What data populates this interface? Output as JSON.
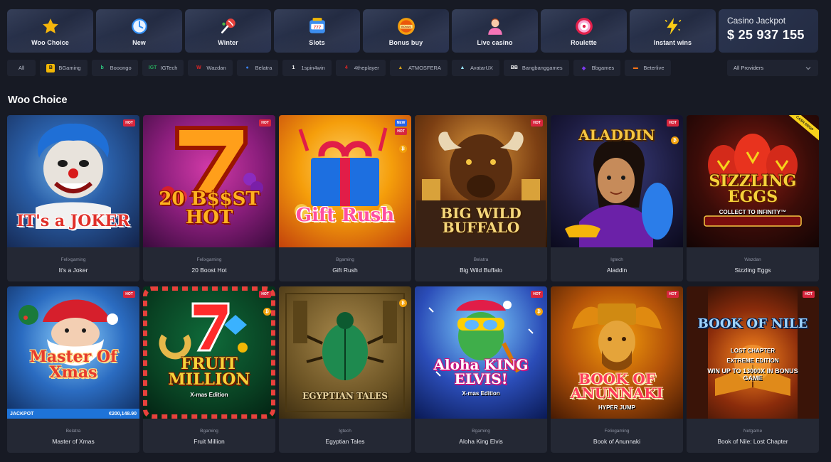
{
  "nav": {
    "categories": [
      {
        "label": "Woo Choice",
        "icon": "star-icon"
      },
      {
        "label": "New",
        "icon": "clock-icon"
      },
      {
        "label": "Winter",
        "icon": "candy-icon"
      },
      {
        "label": "Slots",
        "icon": "slot-machine-icon"
      },
      {
        "label": "Bonus buy",
        "icon": "bonus-coin-icon"
      },
      {
        "label": "Live casino",
        "icon": "dealer-icon"
      },
      {
        "label": "Roulette",
        "icon": "roulette-icon"
      },
      {
        "label": "Instant wins",
        "icon": "lightning-icon"
      }
    ],
    "jackpot": {
      "title": "Casino Jackpot",
      "amount": "$ 25 937 155"
    }
  },
  "providers": {
    "items": [
      "All",
      "BGaming",
      "Booongo",
      "IGTech",
      "Wazdan",
      "Belatra",
      "1spin4win",
      "4theplayer",
      "ATMOSFERA",
      "AvatarUX",
      "Bangbanggames",
      "Bbgames",
      "Beterlive"
    ],
    "logos": [
      "",
      "B",
      "b",
      "IGT",
      "W",
      "●",
      "1",
      "4",
      "▲",
      "▲",
      "BB",
      "◆",
      "▬"
    ],
    "logo_colors": [
      "",
      "#f2b705",
      "#2ec27e",
      "#27a35a",
      "#e02424",
      "#3b82f6",
      "#ffffff",
      "#e02424",
      "#d6a21a",
      "#9be7ff",
      "#ffffff",
      "#7c3aed",
      "#f97316"
    ],
    "select": {
      "value": "All Providers"
    }
  },
  "section": {
    "title": "Woo Choice"
  },
  "games": [
    {
      "provider": "Felixgaming",
      "name": "It's a Joker",
      "art_text": "IT's a JOKER",
      "badges": [
        "HOT"
      ],
      "coin": false
    },
    {
      "provider": "Felixgaming",
      "name": "20 Boost Hot",
      "art_text": "20 B$$ST HOT",
      "badges": [
        "HOT"
      ],
      "coin": false
    },
    {
      "provider": "Bgaming",
      "name": "Gift Rush",
      "art_text": "Gift Rush",
      "badges": [
        "NEW",
        "HOT"
      ],
      "coin": true
    },
    {
      "provider": "Belatra",
      "name": "Big Wild Buffalo",
      "art_text": "BIG WILD BUFFALO",
      "badges": [
        "HOT"
      ],
      "coin": false
    },
    {
      "provider": "Igtech",
      "name": "Aladdin",
      "art_text": "ALADDIN",
      "badges": [
        "HOT"
      ],
      "coin": true
    },
    {
      "provider": "Wazdan",
      "name": "Sizzling Eggs",
      "art_text": "SIZZLING EGGS",
      "art_sub": "COLLECT TO INFINITY™",
      "badges": [],
      "coin": false,
      "ribbon": "CASH DROP"
    },
    {
      "provider": "Belatra",
      "name": "Master of Xmas",
      "art_text": "Master Of Xmas",
      "badges": [
        "HOT"
      ],
      "coin": false,
      "jackpot_label": "JACKPOT",
      "jackpot_value": "€200,148.90"
    },
    {
      "provider": "Bgaming",
      "name": "Fruit Million",
      "art_text": "FRUIT MILLION",
      "art_sub": "X-mas Edition",
      "badges": [
        "HOT"
      ],
      "coin": true
    },
    {
      "provider": "Igtech",
      "name": "Egyptian Tales",
      "art_text": "EGYPTIAN TALES",
      "badges": [],
      "coin": true
    },
    {
      "provider": "Bgaming",
      "name": "Aloha King Elvis",
      "art_text": "Aloha KING ELVIS!",
      "art_sub": "X-mas Edition",
      "badges": [
        "HOT"
      ],
      "coin": true
    },
    {
      "provider": "Felixgaming",
      "name": "Book of Anunnaki",
      "art_text": "BOOK OF ANUNNAKI",
      "art_sub": "HYPER JUMP",
      "badges": [
        "HOT"
      ],
      "coin": false
    },
    {
      "provider": "Netgame",
      "name": "Book of Nile: Lost Chapter",
      "art_text": "BOOK OF NILE",
      "art_sub": "LOST CHAPTER",
      "art_sub2": "EXTREME EDITION",
      "art_sub3": "WIN UP TO 13000X IN BONUS GAME",
      "badges": [
        "HOT"
      ],
      "coin": false
    }
  ],
  "colors": {
    "background": "#171a24",
    "card": "#242834",
    "hot_badge": "#d7263d",
    "coin": "#f2a20c",
    "jackpot_strip": "#1e73d8"
  }
}
